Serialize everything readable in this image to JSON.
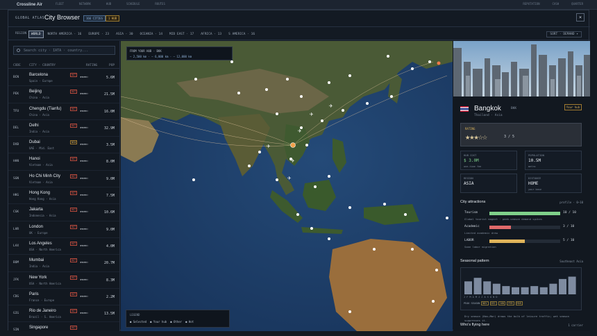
{
  "bg": {
    "brand": "Crossline Air",
    "stats": [
      "FLEET",
      "NETWORK",
      "HUB",
      "SCHEDULE",
      "ROUTES"
    ],
    "rstats": [
      "REPUTATION",
      "CASH",
      "QUARTER"
    ]
  },
  "modal": {
    "tag": "GLOBAL ATLAS",
    "title": "City Browser",
    "badge_count": "166 CITIES",
    "badge_hub": "1 HUB",
    "close": "×"
  },
  "regions": {
    "label": "REGION",
    "tabs": [
      {
        "label": "WORLD",
        "active": true
      },
      {
        "label": "NORTH AMERICA · 16"
      },
      {
        "label": "EUROPE · 23"
      },
      {
        "label": "ASIA · 30"
      },
      {
        "label": "OCEANIA · 14"
      },
      {
        "label": "MID EAST · 17"
      },
      {
        "label": "AFRICA · 13"
      },
      {
        "label": "S AMERICA · 16"
      }
    ],
    "sort": "SORT · DEMAND ▾"
  },
  "list": {
    "search_placeholder": "Search city · IATA · country...",
    "headers": {
      "code": "CODE",
      "city": "CITY · COUNTRY",
      "rating": "RATING",
      "pop": "POP"
    },
    "rows": [
      {
        "code": "BCN",
        "name": "Barcelona",
        "sub": "Spain · Europe",
        "tag": "HOT",
        "stars": "★★★★☆",
        "pop": "5.6M"
      },
      {
        "code": "PEK",
        "name": "Beijing",
        "sub": "China · Asia",
        "tag": "HOT",
        "stars": "★★★★☆",
        "pop": "21.5M"
      },
      {
        "code": "TFU",
        "name": "Chengdu (Tianfu)",
        "sub": "China · Asia",
        "tag": "HOT",
        "stars": "★★★★☆",
        "pop": "16.0M"
      },
      {
        "code": "DEL",
        "name": "Delhi",
        "sub": "India · Asia",
        "tag": "HOT",
        "stars": "★★★★☆",
        "pop": "32.9M"
      },
      {
        "code": "DXB",
        "name": "Dubai",
        "sub": "UAE · Mid. East",
        "tag": "NEW",
        "stars": "★★★★☆",
        "pop": "3.5M"
      },
      {
        "code": "HAN",
        "name": "Hanoi",
        "sub": "Vietnam · Asia",
        "tag": "HOT",
        "stars": "★★★★☆",
        "pop": "8.0M"
      },
      {
        "code": "SGN",
        "name": "Ho Chi Minh City",
        "sub": "Vietnam · Asia",
        "tag": "HOT",
        "stars": "★★★★☆",
        "pop": "9.0M"
      },
      {
        "code": "HKG",
        "name": "Hong Kong",
        "sub": "Hong Kong · Asia",
        "tag": "HOT",
        "stars": "★★★★☆",
        "pop": "7.5M"
      },
      {
        "code": "CGK",
        "name": "Jakarta",
        "sub": "Indonesia · Asia",
        "tag": "HOT",
        "stars": "★★★★☆",
        "pop": "10.6M"
      },
      {
        "code": "LHR",
        "name": "London",
        "sub": "UK · Europe",
        "tag": "HOT",
        "stars": "★★★★☆",
        "pop": "9.0M"
      },
      {
        "code": "LAX",
        "name": "Los Angeles",
        "sub": "USA · North America",
        "tag": "HOT",
        "stars": "★★★★☆",
        "pop": "4.0M"
      },
      {
        "code": "BOM",
        "name": "Mumbai",
        "sub": "India · Asia",
        "tag": "HOT",
        "stars": "★★★★☆",
        "pop": "20.7M"
      },
      {
        "code": "JFK",
        "name": "New York",
        "sub": "USA · North America",
        "tag": "HOT",
        "stars": "★★★★☆",
        "pop": "8.3M"
      },
      {
        "code": "CDG",
        "name": "Paris",
        "sub": "France · Europe",
        "tag": "HOT",
        "stars": "★★★★☆",
        "pop": "2.2M"
      },
      {
        "code": "GIG",
        "name": "Rio de Janeiro",
        "sub": "Brazil · S. America",
        "tag": "HOT",
        "stars": "★★★★☆",
        "pop": "13.5M"
      },
      {
        "code": "SIN",
        "name": "Singapore",
        "sub": "",
        "tag": "HOT",
        "stars": "",
        "pop": ""
      }
    ]
  },
  "map": {
    "flight_title": "FROM YOUR HUB · BKK",
    "flight_ranges": "— 2,500 km · — 6,000 km · — 12,000 km",
    "legend_title": "LEGEND",
    "legend_items": [
      "Selected",
      "Your hub",
      "Other",
      "Hot"
    ]
  },
  "detail": {
    "name": "Bangkok",
    "code": "BKK",
    "sub": "Thailand · Asia",
    "hub_badge": "Your hub",
    "rating_label": "RATING",
    "rating_stars": "★★★☆☆",
    "rating_value": "3 / 5",
    "kpis": [
      {
        "label": "HUB COST",
        "value": "$ 3.0M",
        "sub": "one-time fee"
      },
      {
        "label": "POPULATION",
        "value": "10.5M",
        "sub": "metro"
      },
      {
        "label": "REGION",
        "value": "ASIA",
        "sub": ""
      },
      {
        "label": "DISTANCE",
        "value": "HOME",
        "sub": "your base"
      }
    ],
    "attractions_title": "City attractions",
    "attractions_note": "profile · 0–10",
    "attractions": [
      {
        "name": "Tourism",
        "score": "10 / 10",
        "value": 1.0,
        "color": "#7fd08a",
        "desc": "Global tourist magnet · peak-season demand spikes"
      },
      {
        "name": "Academic",
        "score": "3 / 10",
        "value": 0.3,
        "color": "#e06a6a",
        "desc": "Limited academic draw"
      },
      {
        "name": "LABOR",
        "score": "5 / 10",
        "value": 0.5,
        "color": "#e0b45a",
        "desc": "Some labor migration"
      }
    ],
    "season_title": "Seasonal pattern",
    "season_region": "Southeast Asia",
    "season_values": [
      0.55,
      0.7,
      0.55,
      0.45,
      0.35,
      0.3,
      0.3,
      0.35,
      0.3,
      0.45,
      0.65,
      0.75
    ],
    "months": "J F M A M J J A S O N D",
    "peak_label": "PEAK SEASON",
    "peak_months": [
      "NOV",
      "DEC",
      "JAN",
      "FEB",
      "MAR"
    ],
    "season_note": "Dry season (Nov–Mar) draws the bulk of leisure traffic; wet season suppresses it.",
    "who_title": "Who's flying here",
    "who_right": "1 carrier"
  }
}
